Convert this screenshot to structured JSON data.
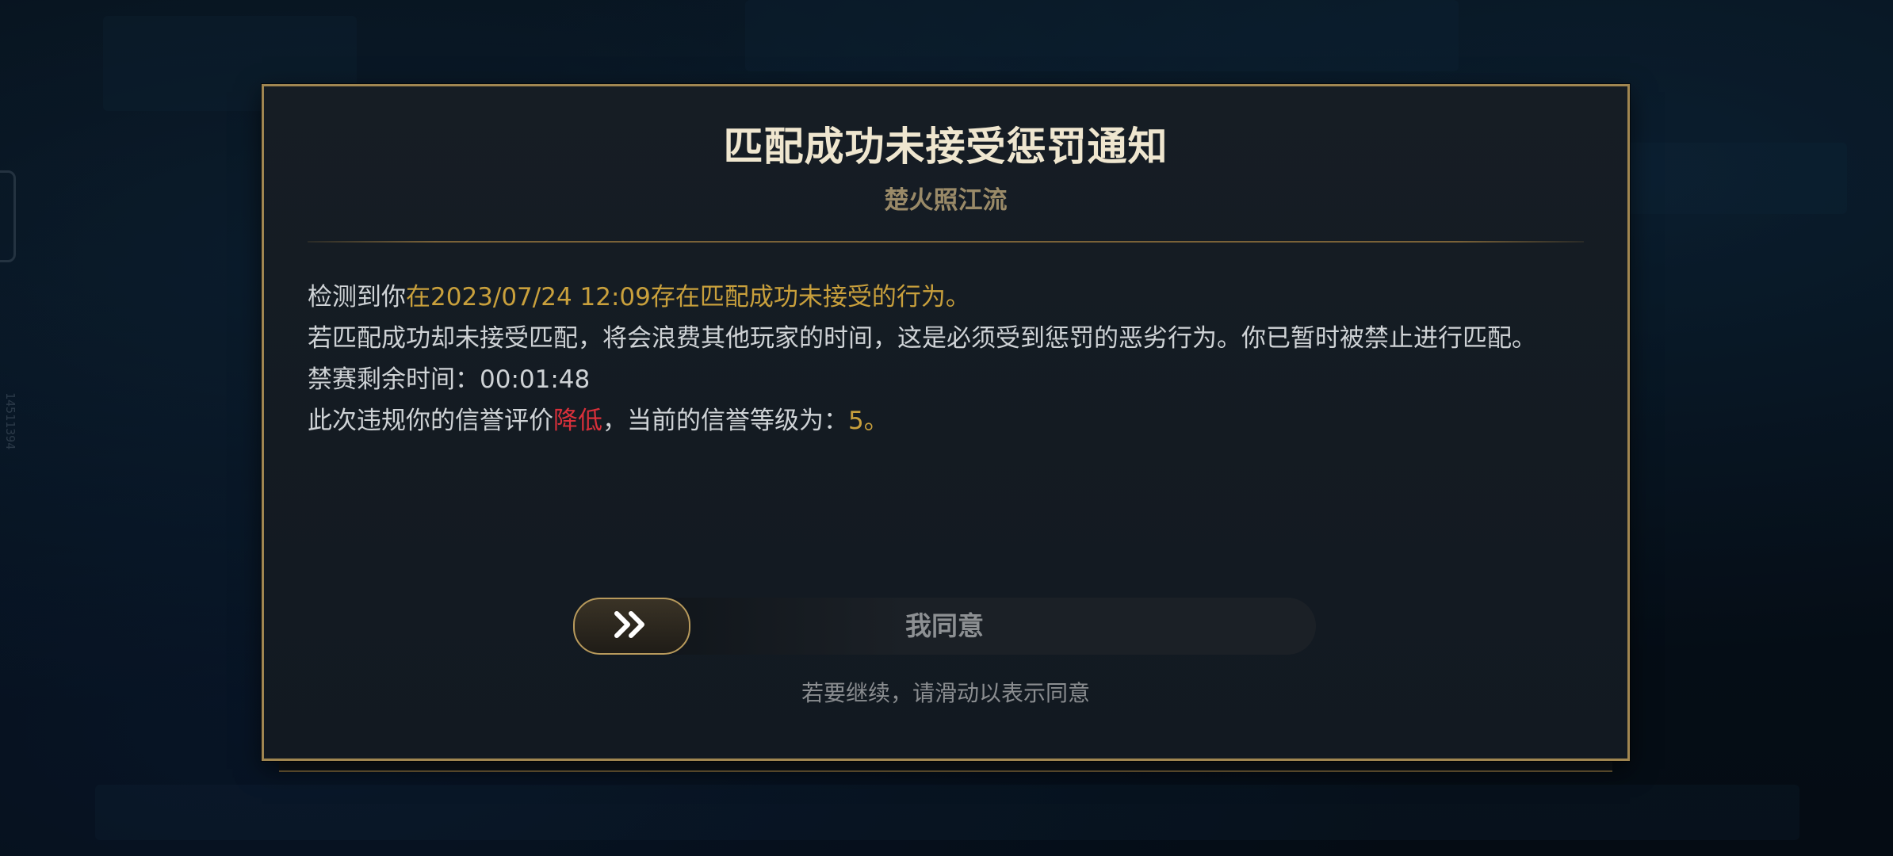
{
  "background": {
    "side_id": "14511394"
  },
  "dialog": {
    "title": "匹配成功未接受惩罚通知",
    "subtitle": "楚火照江流",
    "line1": {
      "prefix": "检测到你",
      "highlight": "在2023/07/24 12:09存在匹配成功未接受的行为。"
    },
    "line2": "若匹配成功却未接受匹配，将会浪费其他玩家的时间，这是必须受到惩罚的恶劣行为。你已暂时被禁止进行匹配。",
    "line3": {
      "label": "禁赛剩余时间：",
      "value": "00:01:48"
    },
    "line4": {
      "prefix": "此次违规你的信誉评价",
      "change": "降低",
      "middle": "，当前的信誉等级为：",
      "level": "5。"
    },
    "slider": {
      "label": "我同意",
      "handle_icon": "double-chevron-right-icon"
    },
    "hint": "若要继续，请滑动以表示同意"
  },
  "colors": {
    "accent_gold": "#c9a03c",
    "warning_red": "#d8303a",
    "border_gold": "#a08651"
  }
}
